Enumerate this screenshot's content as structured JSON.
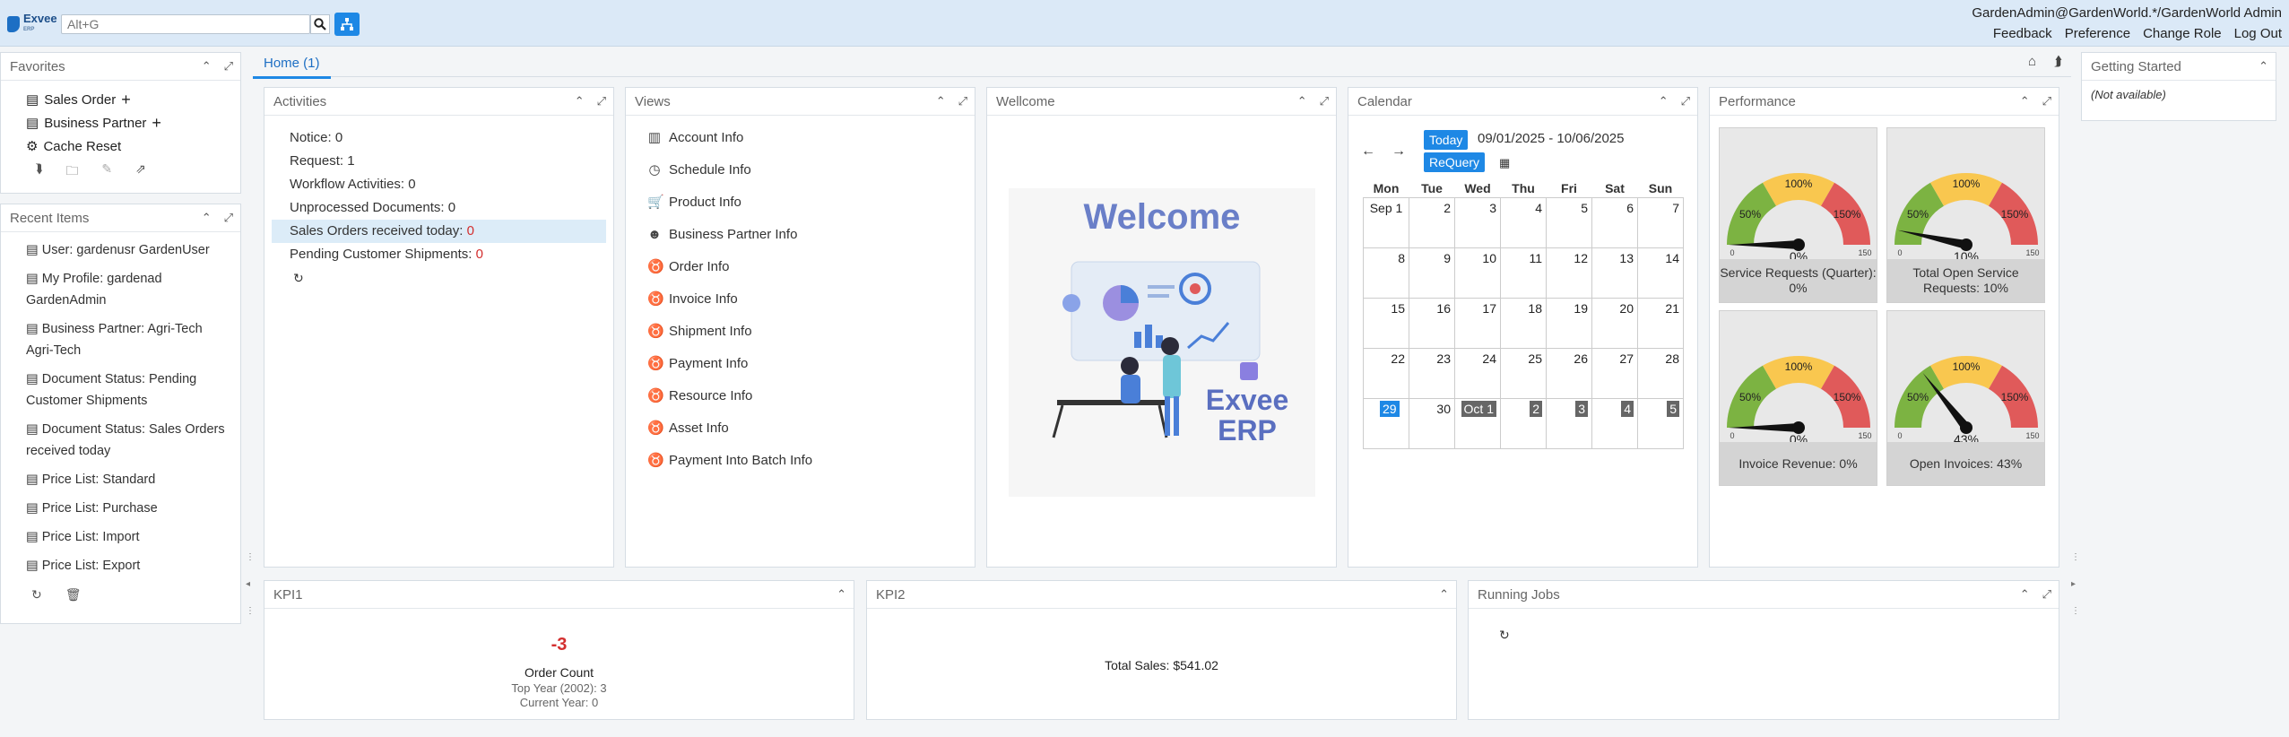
{
  "header": {
    "logo_text": "Exvee",
    "logo_sub": "ERP",
    "search_placeholder": "Alt+G",
    "user": "GardenAdmin@GardenWorld.*/GardenWorld Admin",
    "links": [
      "Feedback",
      "Preference",
      "Change Role",
      "Log Out"
    ]
  },
  "favorites": {
    "title": "Favorites",
    "items": [
      "Sales Order",
      "Business Partner",
      "Cache Reset"
    ]
  },
  "recent": {
    "title": "Recent Items",
    "items": [
      "User: gardenusr GardenUser",
      "My Profile: gardenad GardenAdmin",
      "Business Partner: Agri-Tech Agri-Tech",
      "Document Status: Pending Customer Shipments",
      "Document Status: Sales Orders received today",
      "Price List: Standard",
      "Price List: Purchase",
      "Price List: Import",
      "Price List: Export"
    ]
  },
  "tabs": {
    "home": "Home (1)"
  },
  "activities": {
    "title": "Activities",
    "items": [
      {
        "label": "Notice: ",
        "value": "0"
      },
      {
        "label": "Request: ",
        "value": "1"
      },
      {
        "label": "Workflow Activities: ",
        "value": "0"
      },
      {
        "label": "Unprocessed Documents: ",
        "value": "0"
      },
      {
        "label": "Sales Orders received today: ",
        "value": "0"
      },
      {
        "label": "Pending Customer Shipments: ",
        "value": "0"
      }
    ]
  },
  "views": {
    "title": "Views",
    "items": [
      "Account Info",
      "Schedule Info",
      "Product Info",
      "Business Partner Info",
      "Order Info",
      "Invoice Info",
      "Shipment Info",
      "Payment Info",
      "Resource Info",
      "Asset Info",
      "Payment Into Batch Info"
    ]
  },
  "welcome": {
    "title": "Wellcome",
    "banner": "Welcome",
    "brand1": "Exvee",
    "brand2": "ERP"
  },
  "calendar": {
    "title": "Calendar",
    "today_btn": "Today",
    "requery_btn": "ReQuery",
    "range": "09/01/2025 - 10/06/2025",
    "days": [
      "Mon",
      "Tue",
      "Wed",
      "Thu",
      "Fri",
      "Sat",
      "Sun"
    ],
    "weeks": [
      [
        "Sep 1",
        "2",
        "3",
        "4",
        "5",
        "6",
        "7"
      ],
      [
        "8",
        "9",
        "10",
        "11",
        "12",
        "13",
        "14"
      ],
      [
        "15",
        "16",
        "17",
        "18",
        "19",
        "20",
        "21"
      ],
      [
        "22",
        "23",
        "24",
        "25",
        "26",
        "27",
        "28"
      ],
      [
        "29",
        "30",
        "Oct 1",
        "2",
        "3",
        "4",
        "5"
      ]
    ],
    "today": "29"
  },
  "performance": {
    "title": "Performance",
    "gauges": [
      {
        "label": "Service Requests (Quarter): 0%",
        "value": 0,
        "readout": "0%"
      },
      {
        "label": "Total Open Service Requests: 10%",
        "value": 10,
        "readout": "10%"
      },
      {
        "label": "Invoice Revenue: 0%",
        "value": 0,
        "readout": "0%"
      },
      {
        "label": "Open Invoices: 43%",
        "value": 43,
        "readout": "43%"
      }
    ],
    "ticks": [
      "50%",
      "100%",
      "150%",
      "0",
      "150"
    ]
  },
  "getting_started": {
    "title": "Getting Started",
    "text": "(Not available)"
  },
  "kpi1": {
    "title": "KPI1",
    "value": "-3",
    "label": "Order Count",
    "top_year": "Top Year (2002): 3",
    "current_year": "Current Year: 0"
  },
  "kpi2": {
    "title": "KPI2",
    "total": "Total Sales: $541.02"
  },
  "jobs": {
    "title": "Running Jobs"
  },
  "colors": {
    "accent": "#1e88e5",
    "alert": "#d32f2f",
    "gauge_green": "#7cb342",
    "gauge_yellow": "#f9c74f",
    "gauge_red": "#e05a5a"
  }
}
